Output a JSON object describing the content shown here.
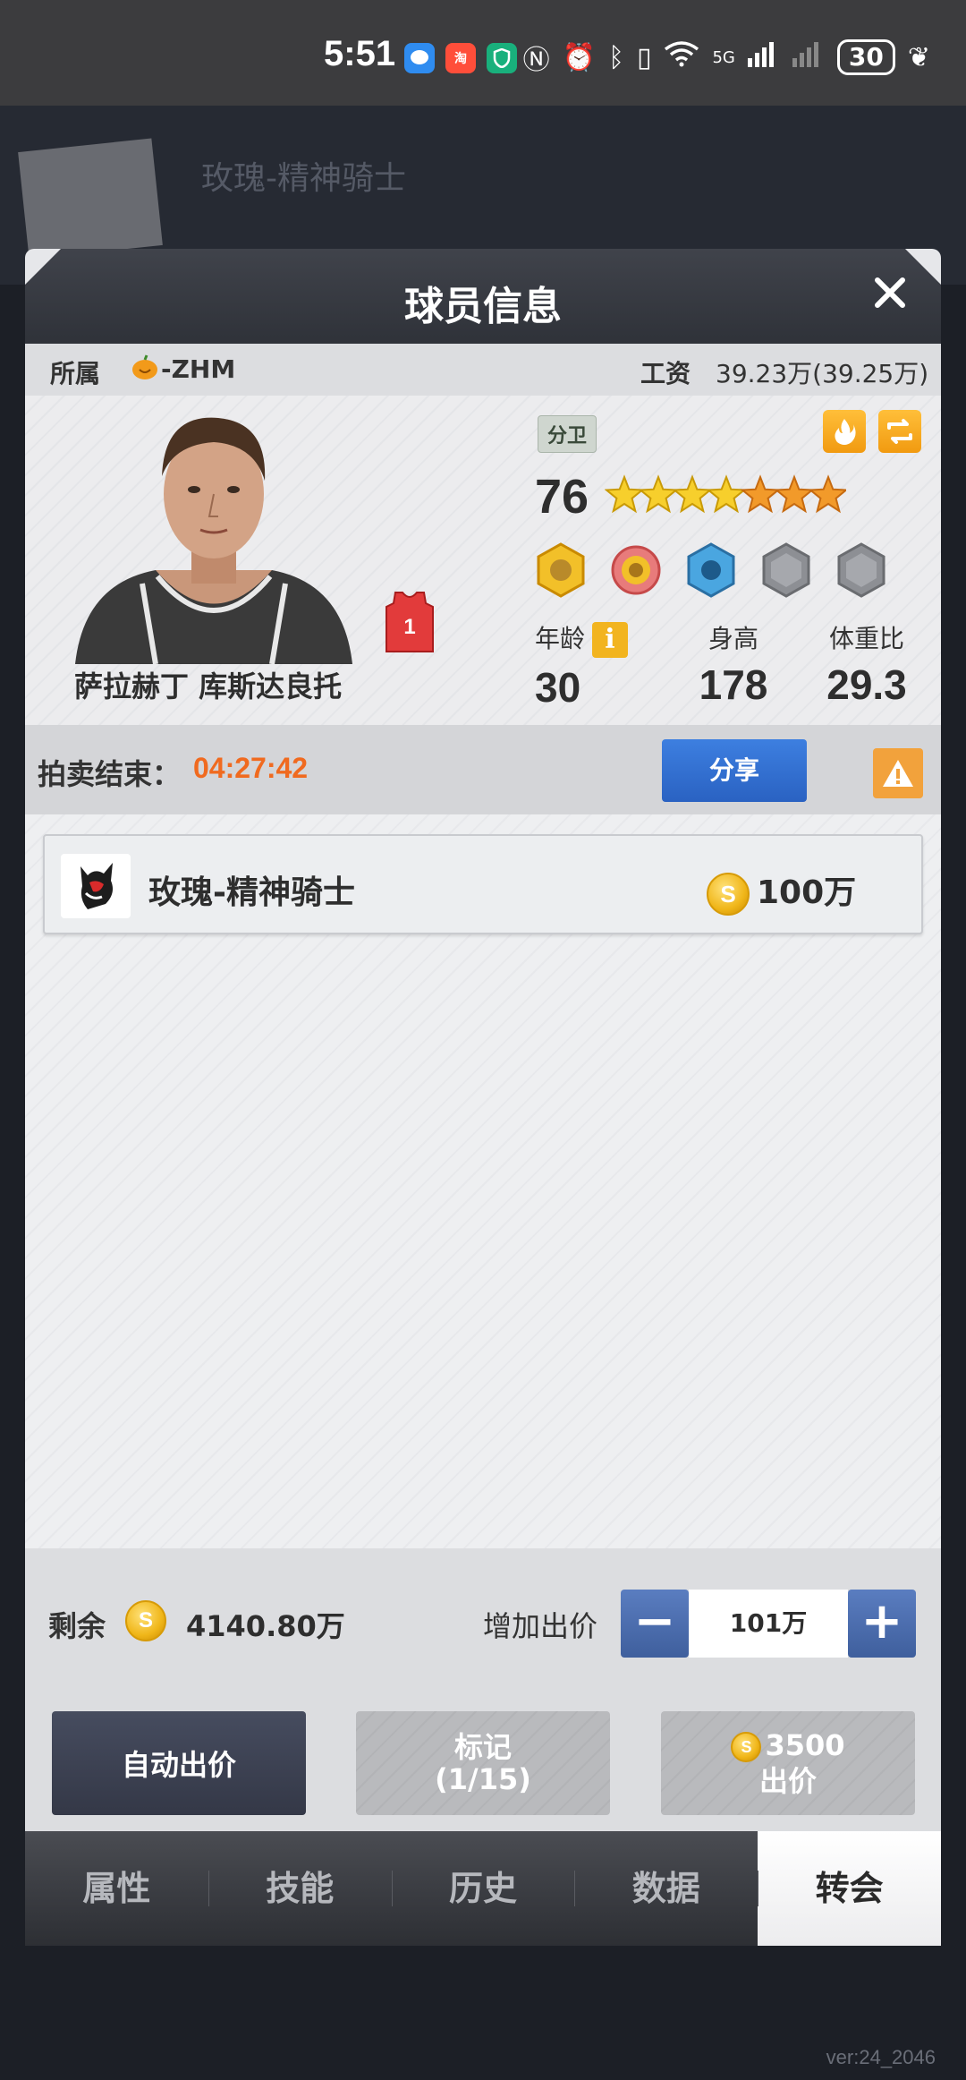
{
  "status_bar": {
    "time": "5:51",
    "battery": "30",
    "network": "5G"
  },
  "background": {
    "team_title": "玫瑰-精神骑士",
    "version": "ver:24_2046"
  },
  "modal": {
    "title": "球员信息",
    "affiliation_label": "所属",
    "affiliation_value": "-ZHM",
    "salary_label": "工资",
    "salary_value": "39.23万(39.25万)",
    "player": {
      "name": "萨拉赫丁 库斯达良托",
      "position": "分卫",
      "rating": "76",
      "jersey_number": "1",
      "stars_total": 7,
      "stars_gold": 4,
      "age_label": "年龄",
      "age": "30",
      "height_label": "身高",
      "height": "178",
      "weight_ratio_label": "体重比",
      "weight_ratio": "29.3",
      "info_icon": "i"
    },
    "auction": {
      "label": "拍卖结束：",
      "time_left": "04:27:42",
      "share_label": "分享"
    },
    "bids": [
      {
        "team": "玫瑰-精神骑士",
        "amount": "100万"
      }
    ],
    "remaining_label": "剩余",
    "remaining_value": "4140.80万",
    "increase_label": "增加出价",
    "stepper_value": "101万",
    "minus": "−",
    "plus": "+",
    "auto_bid_label": "自动出价",
    "mark_label": "标记",
    "mark_count": "(1/15)",
    "bid_price": "3500",
    "bid_label": "出价"
  },
  "tabs": [
    {
      "label": "属性",
      "active": false
    },
    {
      "label": "技能",
      "active": false
    },
    {
      "label": "历史",
      "active": false
    },
    {
      "label": "数据",
      "active": false
    },
    {
      "label": "转会",
      "active": true
    }
  ],
  "colors": {
    "accent_orange": "#f06a1f",
    "share_blue": "#2a62c2",
    "coin_gold": "#f0b619"
  }
}
